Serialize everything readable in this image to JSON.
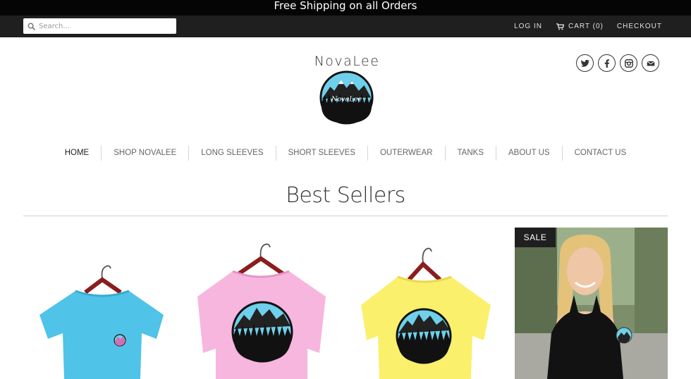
{
  "announcement": "Free Shipping on all Orders",
  "search": {
    "placeholder": "Search..."
  },
  "header_links": {
    "login": "LOG IN",
    "cart": "CART (0)",
    "checkout": "CHECKOUT"
  },
  "logo": {
    "text": "NovaLee",
    "badge_text": "NovaLee"
  },
  "social": [
    "twitter-icon",
    "facebook-icon",
    "instagram-icon",
    "email-icon"
  ],
  "nav": [
    "HOME",
    "SHOP NOVALEE",
    "LONG SLEEVES",
    "SHORT SLEEVES",
    "OUTERWEAR",
    "TANKS",
    "ABOUT US",
    "CONTACT US"
  ],
  "section": {
    "title": "Best Sellers"
  },
  "products": [
    {
      "color": "#4fc3e8",
      "logo": "pocket",
      "sale": ""
    },
    {
      "color": "#f7b6de",
      "logo": "large",
      "sale": ""
    },
    {
      "color": "#fbf06c",
      "logo": "large",
      "sale": ""
    },
    {
      "color": "#111111",
      "logo": "model",
      "sale": "SALE"
    }
  ],
  "colors": {
    "announce_bg": "#050505",
    "topbar_bg": "#1f1f1f",
    "badge_blue": "#6ed0ea"
  }
}
